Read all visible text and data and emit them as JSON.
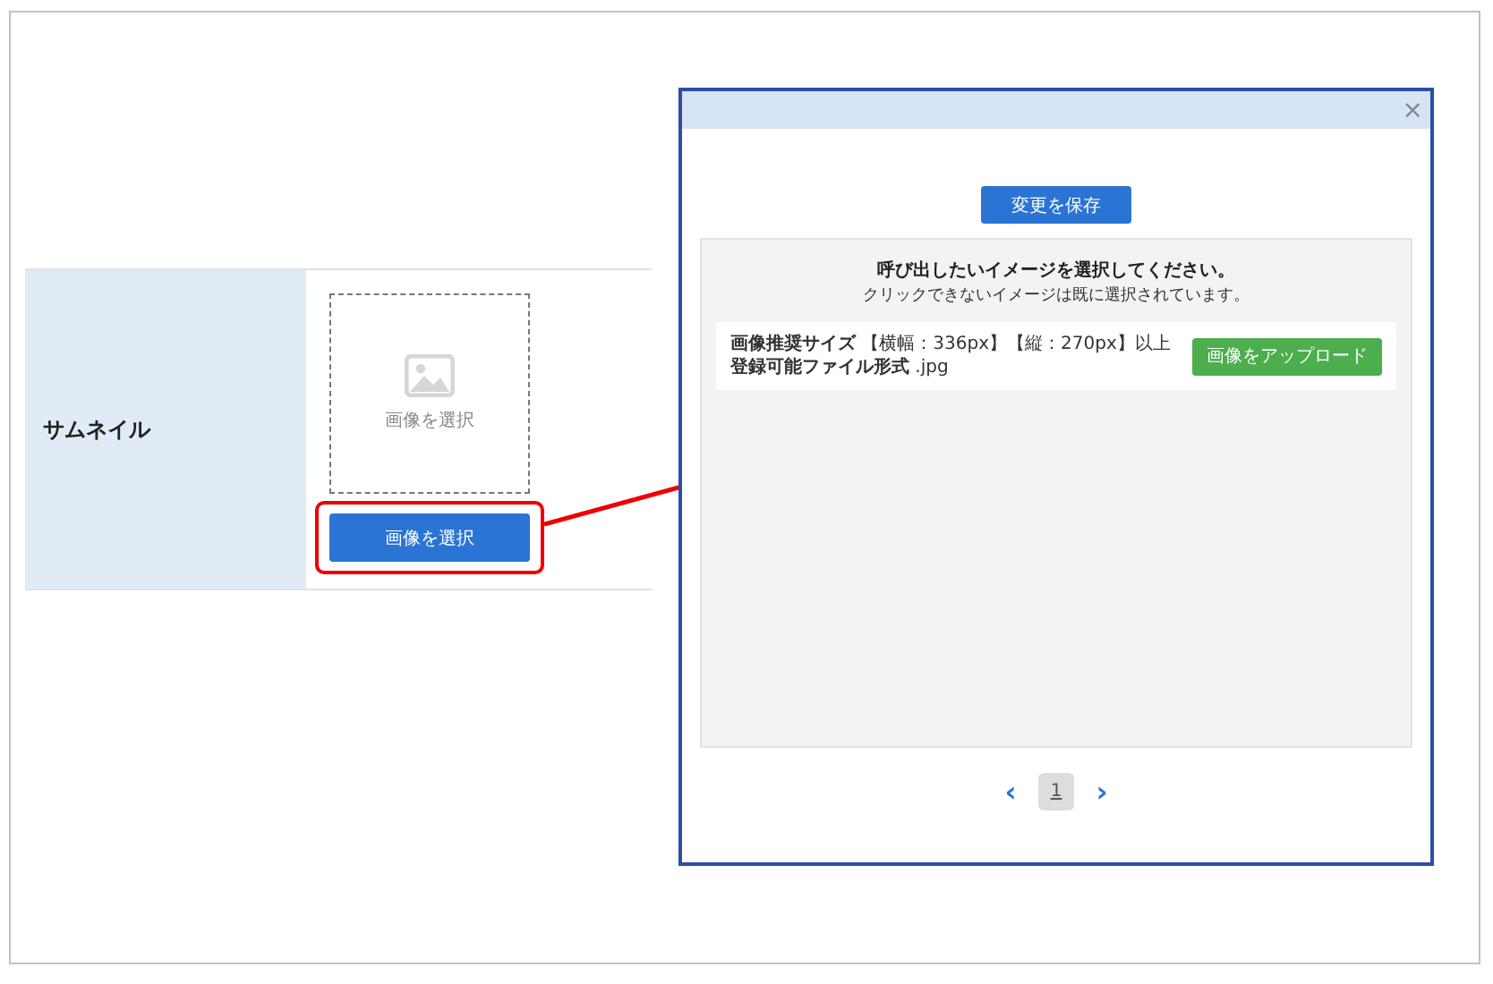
{
  "form": {
    "label": "サムネイル",
    "preview_text": "画像を選択",
    "button": "画像を選択"
  },
  "modal": {
    "close": "×",
    "save_button": "変更を保存",
    "heading": "呼び出したいイメージを選択してください。",
    "note": "クリックできないイメージは既に選択されています。",
    "size_info": "**画像推奨サイズ** 【横幅：336px】【縦：270px】以上",
    "format_info": "**登録可能ファイル形式** .jpg",
    "upload_button": "画像をアップロード",
    "pagination": {
      "prev": "‹",
      "next": "›",
      "pages": [
        {
          "label": "1",
          "selected": true
        }
      ]
    }
  }
}
